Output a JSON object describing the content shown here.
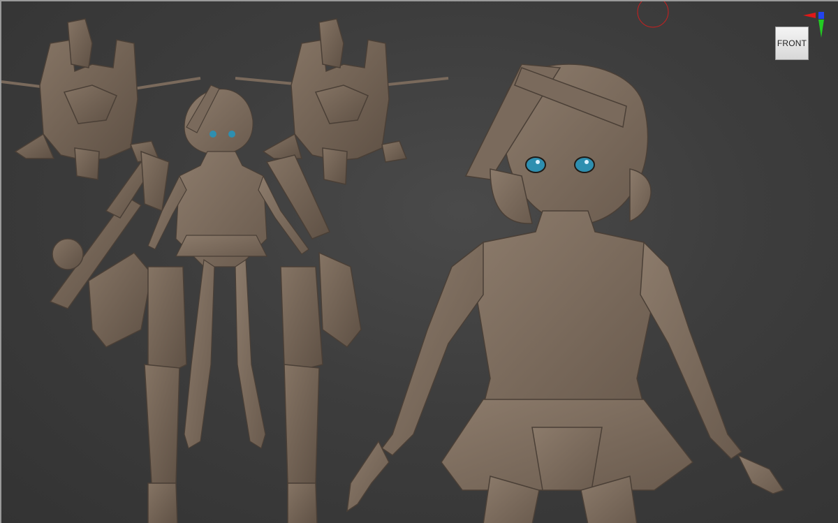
{
  "viewport": {
    "view_label": "FRONT",
    "background_color": "#3d3d3d",
    "model_color": "#7a6a5c",
    "eye_color": "#2e8fb0"
  },
  "gizmo": {
    "x_axis_color": "#e01818",
    "y_axis_color": "#22cc22",
    "z_axis_color": "#2244ee"
  },
  "icons": {
    "view_cube": "view-cube-icon",
    "axis_gizmo": "axis-gizmo-icon",
    "camera_target": "camera-target-icon"
  }
}
